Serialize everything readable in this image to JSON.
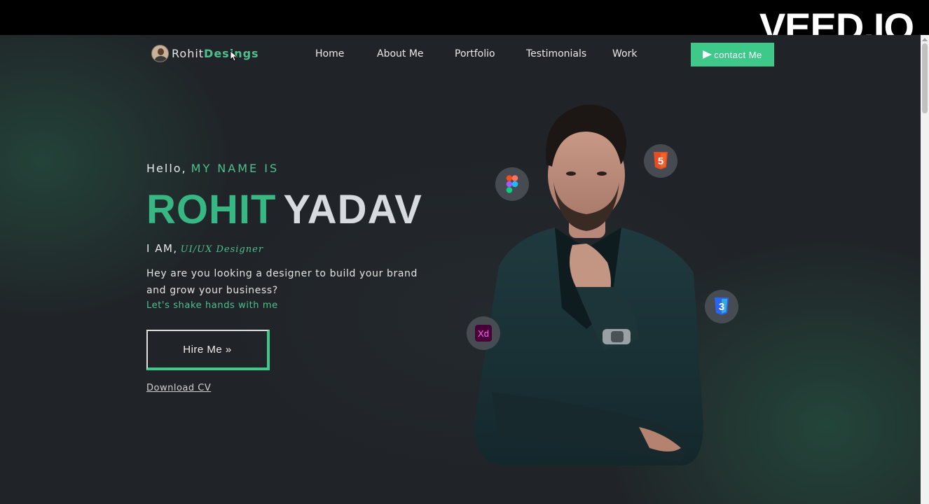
{
  "watermark": "VEED.IO",
  "brand": {
    "name_part1": "Rohit",
    "name_part2": "Desings"
  },
  "nav": {
    "items": [
      {
        "label": "Home"
      },
      {
        "label": "About Me"
      },
      {
        "label": "Portfolio"
      },
      {
        "label": "Testimonials"
      },
      {
        "label": "Work"
      }
    ],
    "contact_label": "contact Me"
  },
  "hero": {
    "greeting": "Hello,",
    "greeting_accent": "MY NAME IS",
    "first_name": "ROHIT",
    "last_name": "YADAV",
    "iam_prefix": "I AM,",
    "role": "UI/UX Designer",
    "description": "Hey are you looking a designer to build your brand and grow your business?",
    "tagline": "Let's shake hands with me",
    "hire_label": "Hire Me »",
    "download_label": "Download CV"
  },
  "skill_badges": [
    {
      "icon": "figma-icon"
    },
    {
      "icon": "html5-icon",
      "label": "5"
    },
    {
      "icon": "adobe-xd-icon",
      "label": "Xd"
    },
    {
      "icon": "css3-icon",
      "label": "3"
    }
  ],
  "colors": {
    "accent": "#3ec98b",
    "background": "#202428",
    "html5": "#e44d26",
    "css3": "#2965f1",
    "xd": "#470137",
    "xd_text": "#ff61f6"
  }
}
